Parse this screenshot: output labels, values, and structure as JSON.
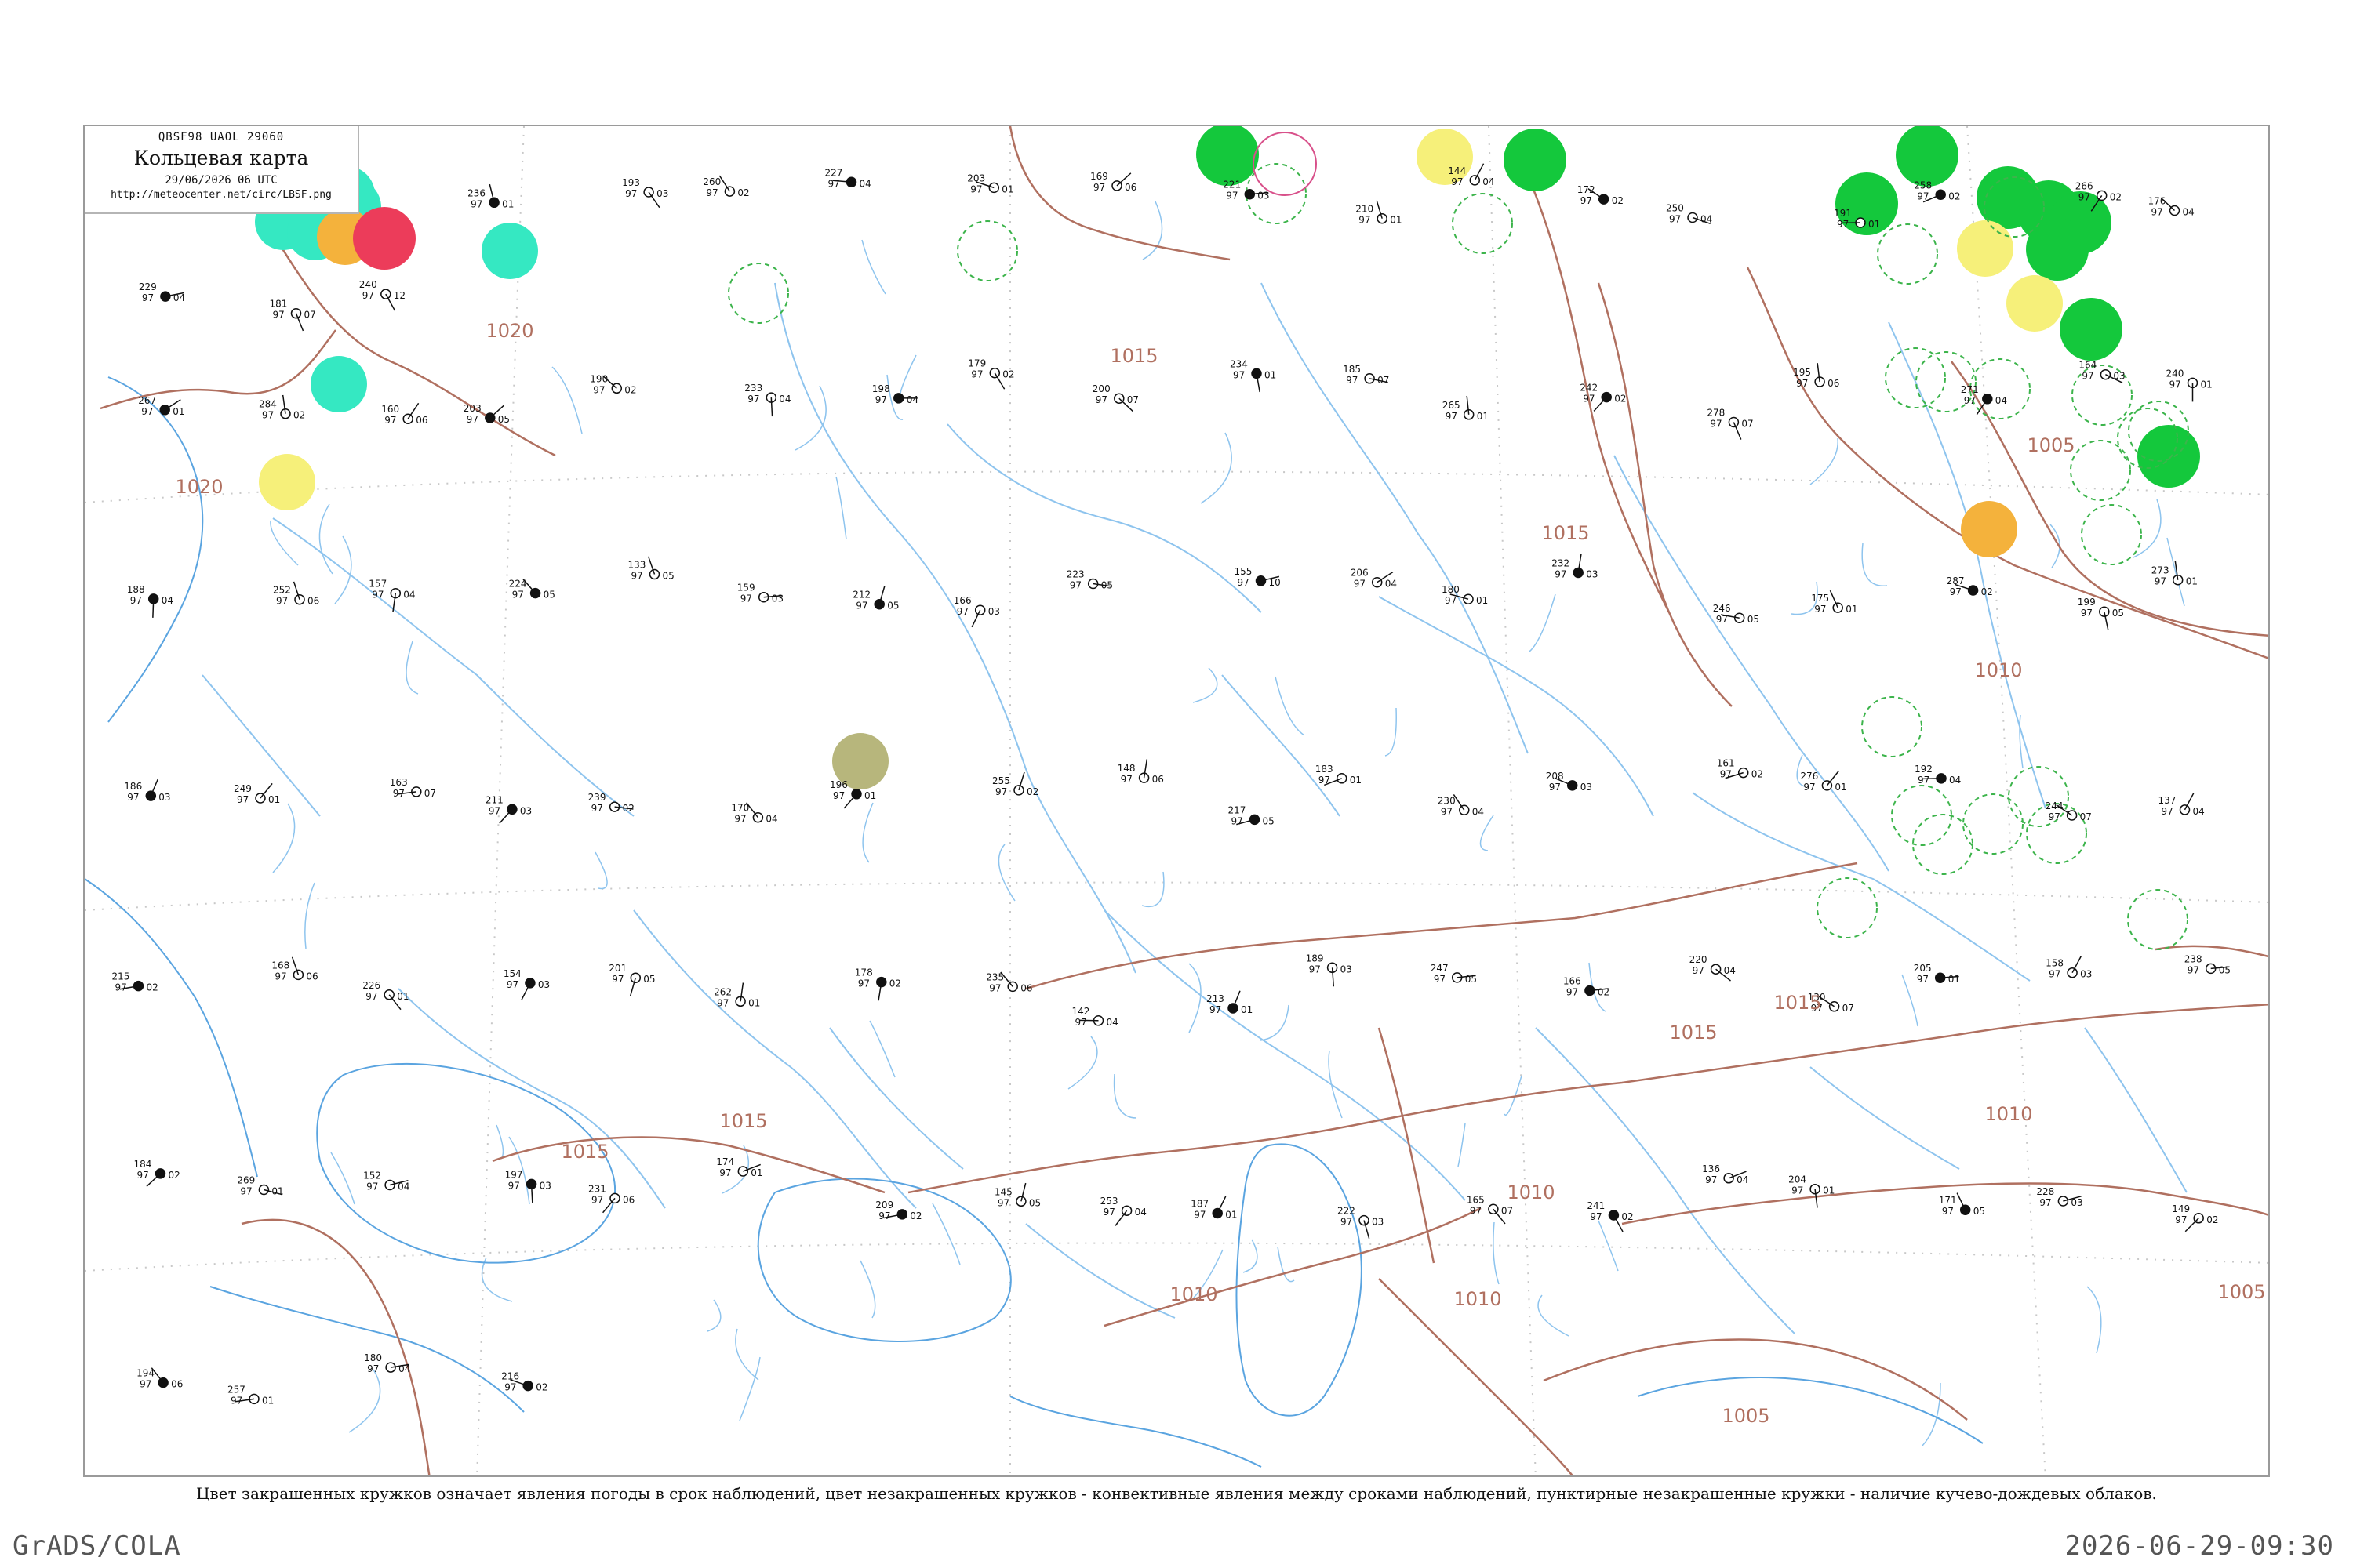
{
  "header": {
    "code": "QBSF98  UAOL  29060",
    "title": "Кольцевая карта",
    "date": "29/06/2026 06 UTC",
    "url": "http://meteocenter.net/circ/LBSF.png"
  },
  "caption": "Цвет закрашенных кружков означает явления погоды в срок наблюдений, цвет незакрашенных кружков - конвективные явления между сроками наблюдений, пунктирные незакрашенные кружки - наличие кучево-дождевых облаков.",
  "footer": {
    "left": "GrADS/COLA",
    "right": "2026-06-29-09:30"
  },
  "colors": {
    "isobar": "#b07060",
    "river": "#8ec4ee",
    "coast": "#5aa4e0",
    "grid": "#c8c8c8",
    "station": "#111111",
    "dashed_circle": "#3cb44b",
    "green": "#14c83c",
    "cyan": "#35e8c2",
    "yellow": "#f6f07a",
    "orange": "#f4b23c",
    "red": "#ec3c5a",
    "olive": "#b7b67c",
    "pink_ring": "#d8508a"
  },
  "isobar_labels": [
    {
      "text": "1020"
    },
    {
      "text": "1020"
    },
    {
      "text": "1015"
    },
    {
      "text": "1015"
    },
    {
      "text": "1015"
    },
    {
      "text": "1015"
    },
    {
      "text": "1015"
    },
    {
      "text": "1015"
    },
    {
      "text": "1010"
    },
    {
      "text": "1010"
    },
    {
      "text": "1010"
    },
    {
      "text": "1010"
    },
    {
      "text": "1010"
    },
    {
      "text": "1005"
    },
    {
      "text": "1005"
    },
    {
      "text": "1005"
    },
    {
      "text": "101"
    }
  ],
  "weather_circles": [
    {
      "kind": "green",
      "label": ""
    },
    {
      "kind": "green",
      "label": ""
    },
    {
      "kind": "green",
      "label": ""
    },
    {
      "kind": "green",
      "label": ""
    },
    {
      "kind": "green",
      "label": ""
    },
    {
      "kind": "green",
      "label": ""
    },
    {
      "kind": "green",
      "label": ""
    },
    {
      "kind": "green",
      "label": ""
    },
    {
      "kind": "green",
      "label": ""
    },
    {
      "kind": "green",
      "label": ""
    },
    {
      "kind": "cyan",
      "label": ""
    },
    {
      "kind": "cyan",
      "label": ""
    },
    {
      "kind": "cyan",
      "label": ""
    },
    {
      "kind": "cyan",
      "label": ""
    },
    {
      "kind": "cyan",
      "label": ""
    },
    {
      "kind": "cyan",
      "label": ""
    },
    {
      "kind": "yellow",
      "label": ""
    },
    {
      "kind": "yellow",
      "label": ""
    },
    {
      "kind": "yellow",
      "label": ""
    },
    {
      "kind": "yellow",
      "label": ""
    },
    {
      "kind": "orange",
      "label": ""
    },
    {
      "kind": "orange",
      "label": ""
    },
    {
      "kind": "red",
      "label": ""
    },
    {
      "kind": "olive",
      "label": ""
    }
  ],
  "stations": [
    {
      "top": "229",
      "mid": "97",
      "bot": "04"
    },
    {
      "top": "181",
      "mid": "97",
      "bot": "07"
    },
    {
      "top": "240",
      "mid": "97",
      "bot": "12"
    },
    {
      "top": "236",
      "mid": "97",
      "bot": "01"
    },
    {
      "top": "193",
      "mid": "97",
      "bot": "03"
    },
    {
      "top": "260",
      "mid": "97",
      "bot": "02"
    },
    {
      "top": "227",
      "mid": "97",
      "bot": "04"
    },
    {
      "top": "203",
      "mid": "97",
      "bot": "01"
    },
    {
      "top": "169",
      "mid": "97",
      "bot": "06"
    },
    {
      "top": "221",
      "mid": "97",
      "bot": "03"
    },
    {
      "top": "210",
      "mid": "97",
      "bot": "01"
    },
    {
      "top": "144",
      "mid": "97",
      "bot": "04"
    },
    {
      "top": "172",
      "mid": "97",
      "bot": "02"
    },
    {
      "top": "250",
      "mid": "97",
      "bot": "04"
    },
    {
      "top": "191",
      "mid": "97",
      "bot": "01"
    },
    {
      "top": "258",
      "mid": "97",
      "bot": "02"
    },
    {
      "top": "266",
      "mid": "97",
      "bot": "02"
    },
    {
      "top": "176",
      "mid": "97",
      "bot": "04"
    },
    {
      "top": "267",
      "mid": "97",
      "bot": "01"
    },
    {
      "top": "284",
      "mid": "97",
      "bot": "02"
    },
    {
      "top": "160",
      "mid": "97",
      "bot": "06"
    },
    {
      "top": "203",
      "mid": "97",
      "bot": "05"
    },
    {
      "top": "190",
      "mid": "97",
      "bot": "02"
    },
    {
      "top": "233",
      "mid": "97",
      "bot": "04"
    },
    {
      "top": "198",
      "mid": "97",
      "bot": "04"
    },
    {
      "top": "179",
      "mid": "97",
      "bot": "02"
    },
    {
      "top": "200",
      "mid": "97",
      "bot": "07"
    },
    {
      "top": "234",
      "mid": "97",
      "bot": "01"
    },
    {
      "top": "185",
      "mid": "97",
      "bot": "07"
    },
    {
      "top": "265",
      "mid": "97",
      "bot": "01"
    },
    {
      "top": "242",
      "mid": "97",
      "bot": "02"
    },
    {
      "top": "278",
      "mid": "97",
      "bot": "07"
    },
    {
      "top": "195",
      "mid": "97",
      "bot": "06"
    },
    {
      "top": "271",
      "mid": "97",
      "bot": "04"
    },
    {
      "top": "164",
      "mid": "97",
      "bot": "03"
    },
    {
      "top": "240",
      "mid": "97",
      "bot": "01"
    },
    {
      "top": "188",
      "mid": "97",
      "bot": "04"
    },
    {
      "top": "252",
      "mid": "97",
      "bot": "06"
    },
    {
      "top": "157",
      "mid": "97",
      "bot": "04"
    },
    {
      "top": "224",
      "mid": "97",
      "bot": "05"
    },
    {
      "top": "133",
      "mid": "97",
      "bot": "05"
    },
    {
      "top": "159",
      "mid": "97",
      "bot": "03"
    },
    {
      "top": "212",
      "mid": "97",
      "bot": "05"
    },
    {
      "top": "166",
      "mid": "97",
      "bot": "03"
    },
    {
      "top": "223",
      "mid": "97",
      "bot": "05"
    },
    {
      "top": "155",
      "mid": "97",
      "bot": "10"
    },
    {
      "top": "206",
      "mid": "97",
      "bot": "04"
    },
    {
      "top": "180",
      "mid": "97",
      "bot": "01"
    },
    {
      "top": "232",
      "mid": "97",
      "bot": "03"
    },
    {
      "top": "246",
      "mid": "97",
      "bot": "05"
    },
    {
      "top": "175",
      "mid": "97",
      "bot": "01"
    },
    {
      "top": "287",
      "mid": "97",
      "bot": "02"
    },
    {
      "top": "199",
      "mid": "97",
      "bot": "05"
    },
    {
      "top": "273",
      "mid": "97",
      "bot": "01"
    },
    {
      "top": "186",
      "mid": "97",
      "bot": "03"
    },
    {
      "top": "249",
      "mid": "97",
      "bot": "01"
    },
    {
      "top": "163",
      "mid": "97",
      "bot": "07"
    },
    {
      "top": "211",
      "mid": "97",
      "bot": "03"
    },
    {
      "top": "239",
      "mid": "97",
      "bot": "02"
    },
    {
      "top": "170",
      "mid": "97",
      "bot": "04"
    },
    {
      "top": "196",
      "mid": "97",
      "bot": "01"
    },
    {
      "top": "255",
      "mid": "97",
      "bot": "02"
    },
    {
      "top": "148",
      "mid": "97",
      "bot": "06"
    },
    {
      "top": "217",
      "mid": "97",
      "bot": "05"
    },
    {
      "top": "183",
      "mid": "97",
      "bot": "01"
    },
    {
      "top": "230",
      "mid": "97",
      "bot": "04"
    },
    {
      "top": "208",
      "mid": "97",
      "bot": "03"
    },
    {
      "top": "161",
      "mid": "97",
      "bot": "02"
    },
    {
      "top": "276",
      "mid": "97",
      "bot": "01"
    },
    {
      "top": "192",
      "mid": "97",
      "bot": "04"
    },
    {
      "top": "244",
      "mid": "97",
      "bot": "07"
    },
    {
      "top": "137",
      "mid": "97",
      "bot": "04"
    },
    {
      "top": "215",
      "mid": "97",
      "bot": "02"
    },
    {
      "top": "168",
      "mid": "97",
      "bot": "06"
    },
    {
      "top": "226",
      "mid": "97",
      "bot": "01"
    },
    {
      "top": "154",
      "mid": "97",
      "bot": "03"
    },
    {
      "top": "201",
      "mid": "97",
      "bot": "05"
    },
    {
      "top": "262",
      "mid": "97",
      "bot": "01"
    },
    {
      "top": "178",
      "mid": "97",
      "bot": "02"
    },
    {
      "top": "235",
      "mid": "97",
      "bot": "06"
    },
    {
      "top": "142",
      "mid": "97",
      "bot": "04"
    },
    {
      "top": "213",
      "mid": "97",
      "bot": "01"
    },
    {
      "top": "189",
      "mid": "97",
      "bot": "03"
    },
    {
      "top": "247",
      "mid": "97",
      "bot": "05"
    },
    {
      "top": "166",
      "mid": "97",
      "bot": "02"
    },
    {
      "top": "220",
      "mid": "97",
      "bot": "04"
    },
    {
      "top": "130",
      "mid": "97",
      "bot": "07"
    },
    {
      "top": "205",
      "mid": "97",
      "bot": "01"
    },
    {
      "top": "158",
      "mid": "97",
      "bot": "03"
    },
    {
      "top": "238",
      "mid": "97",
      "bot": "05"
    },
    {
      "top": "184",
      "mid": "97",
      "bot": "02"
    },
    {
      "top": "269",
      "mid": "97",
      "bot": "01"
    },
    {
      "top": "152",
      "mid": "97",
      "bot": "04"
    },
    {
      "top": "197",
      "mid": "97",
      "bot": "03"
    },
    {
      "top": "231",
      "mid": "97",
      "bot": "06"
    },
    {
      "top": "174",
      "mid": "97",
      "bot": "01"
    },
    {
      "top": "209",
      "mid": "97",
      "bot": "02"
    },
    {
      "top": "145",
      "mid": "97",
      "bot": "05"
    },
    {
      "top": "253",
      "mid": "97",
      "bot": "04"
    },
    {
      "top": "187",
      "mid": "97",
      "bot": "01"
    },
    {
      "top": "222",
      "mid": "97",
      "bot": "03"
    },
    {
      "top": "165",
      "mid": "97",
      "bot": "07"
    },
    {
      "top": "241",
      "mid": "97",
      "bot": "02"
    },
    {
      "top": "136",
      "mid": "97",
      "bot": "04"
    },
    {
      "top": "204",
      "mid": "97",
      "bot": "01"
    },
    {
      "top": "171",
      "mid": "97",
      "bot": "05"
    },
    {
      "top": "228",
      "mid": "97",
      "bot": "03"
    },
    {
      "top": "149",
      "mid": "97",
      "bot": "02"
    },
    {
      "top": "194",
      "mid": "97",
      "bot": "06"
    },
    {
      "top": "257",
      "mid": "97",
      "bot": "01"
    },
    {
      "top": "180",
      "mid": "97",
      "bot": "04"
    },
    {
      "top": "216",
      "mid": "97",
      "bot": "02"
    }
  ]
}
